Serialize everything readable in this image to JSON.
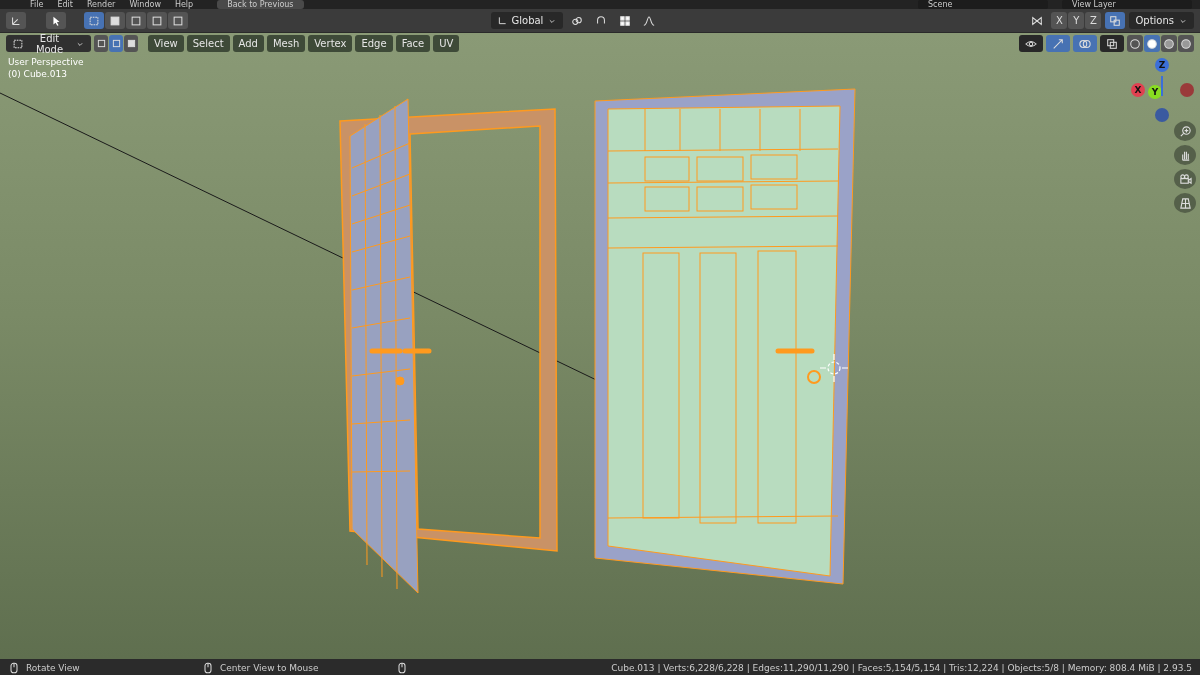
{
  "top_bar": {
    "menus": [
      "File",
      "Edit",
      "Render",
      "Window",
      "Help"
    ],
    "back_button": "Back to Previous",
    "scene": "Scene",
    "view_layer": "View Layer"
  },
  "tool_header": {
    "select_modes": [
      {
        "selected": true
      },
      {
        "selected": false
      },
      {
        "selected": false
      },
      {
        "selected": false
      },
      {
        "selected": false
      }
    ],
    "orientation": "Global",
    "axes": [
      {
        "label": "X",
        "selected": false
      },
      {
        "label": "Y",
        "selected": false
      },
      {
        "label": "Z",
        "selected": false
      }
    ],
    "options": "Options"
  },
  "viewport_header": {
    "mode": "Edit Mode",
    "element_modes": [
      {
        "selected": false
      },
      {
        "selected": true
      },
      {
        "selected": false
      }
    ],
    "menus": [
      "View",
      "Select",
      "Add",
      "Mesh",
      "Vertex",
      "Edge",
      "Face",
      "UV"
    ],
    "shading_modes": [
      {
        "selected": false
      },
      {
        "selected": true
      },
      {
        "selected": false
      },
      {
        "selected": false
      }
    ]
  },
  "overlay_text": [
    "User Perspective",
    "(0) Cube.013"
  ],
  "gizmo": {
    "z": "Z",
    "x": "X",
    "y": "Y"
  },
  "status_bar": {
    "hints": [
      "Rotate View",
      "Center View to Mouse"
    ],
    "stats": "Cube.013 | Verts:6,228/6,228 | Edges:11,290/11,290 | Faces:5,154/5,154 | Tris:12,224 | Objects:5/8 | Memory: 808.4 MiB | 2.93.5"
  }
}
